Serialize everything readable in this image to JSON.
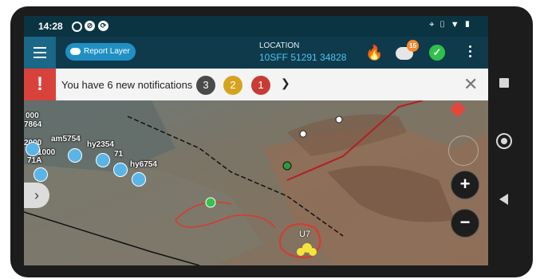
{
  "status_bar": {
    "time": "14:28"
  },
  "app_bar": {
    "report_layer_label": "Report Layer",
    "location_title": "LOCATION",
    "location_value": "10SFF 51291 34828",
    "messages_badge": "15"
  },
  "notifications": {
    "text": "You have 6 new notifications",
    "counts": [
      {
        "value": "3",
        "color": "#4a4a4a"
      },
      {
        "value": "2",
        "color": "#d6a320"
      },
      {
        "value": "1",
        "color": "#c63c36"
      }
    ]
  },
  "map": {
    "labels": [
      "000",
      "7864",
      "2000",
      "am5754",
      "hy2354",
      "1000",
      "71",
      "71A",
      "hy6754",
      "U7"
    ],
    "icons": [
      "flame-icon",
      "chat-icon",
      "check-icon",
      "menu-icon",
      "expand-icon",
      "zoom-in-icon",
      "zoom-out-icon"
    ]
  }
}
